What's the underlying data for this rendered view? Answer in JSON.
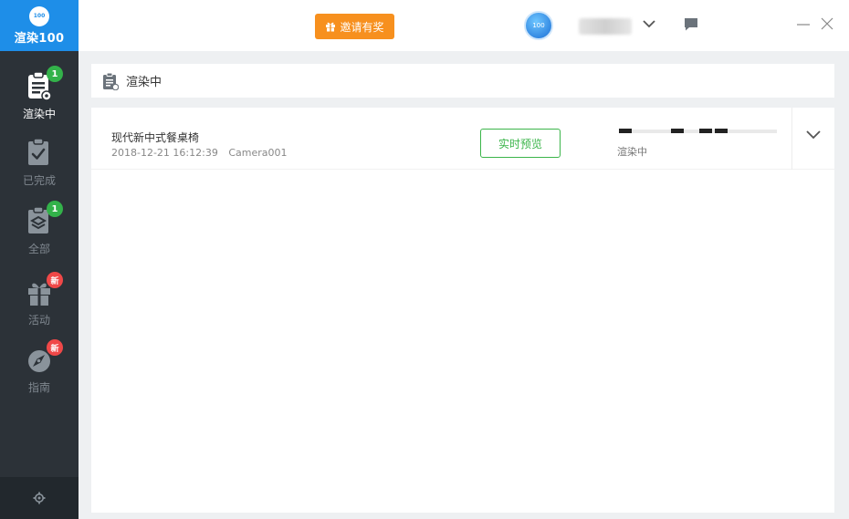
{
  "brand": {
    "logo_text": "100",
    "name": "渲染100"
  },
  "nav": [
    {
      "label": "渲染中",
      "icon": "rendering-list-icon",
      "badge": "1",
      "badge_color": "#33b24a",
      "active": true
    },
    {
      "label": "已完成",
      "icon": "completed-clipboard-icon",
      "badge": null,
      "active": false
    },
    {
      "label": "全部",
      "icon": "all-layers-icon",
      "badge": "1",
      "badge_color": "#33b24a",
      "active": false
    },
    {
      "label": "活动",
      "icon": "gift-icon",
      "badge": "新",
      "badge_color": "#f04848",
      "active": false
    },
    {
      "label": "指南",
      "icon": "compass-icon",
      "badge": "新",
      "badge_color": "#f04848",
      "active": false
    }
  ],
  "topbar": {
    "invite_label": "邀请有奖",
    "avatar_text": "100"
  },
  "section": {
    "title": "渲染中"
  },
  "task": {
    "name": "现代新中式餐桌椅",
    "date": "2018-12-21 16:12:39",
    "camera": "Camera001",
    "preview_label": "实时预览",
    "status": "渲染中"
  },
  "colors": {
    "sidebar": "#2c3238",
    "brand": "#1e8ee8",
    "invite": "#f7901e",
    "accent_green": "#3bb54a"
  }
}
